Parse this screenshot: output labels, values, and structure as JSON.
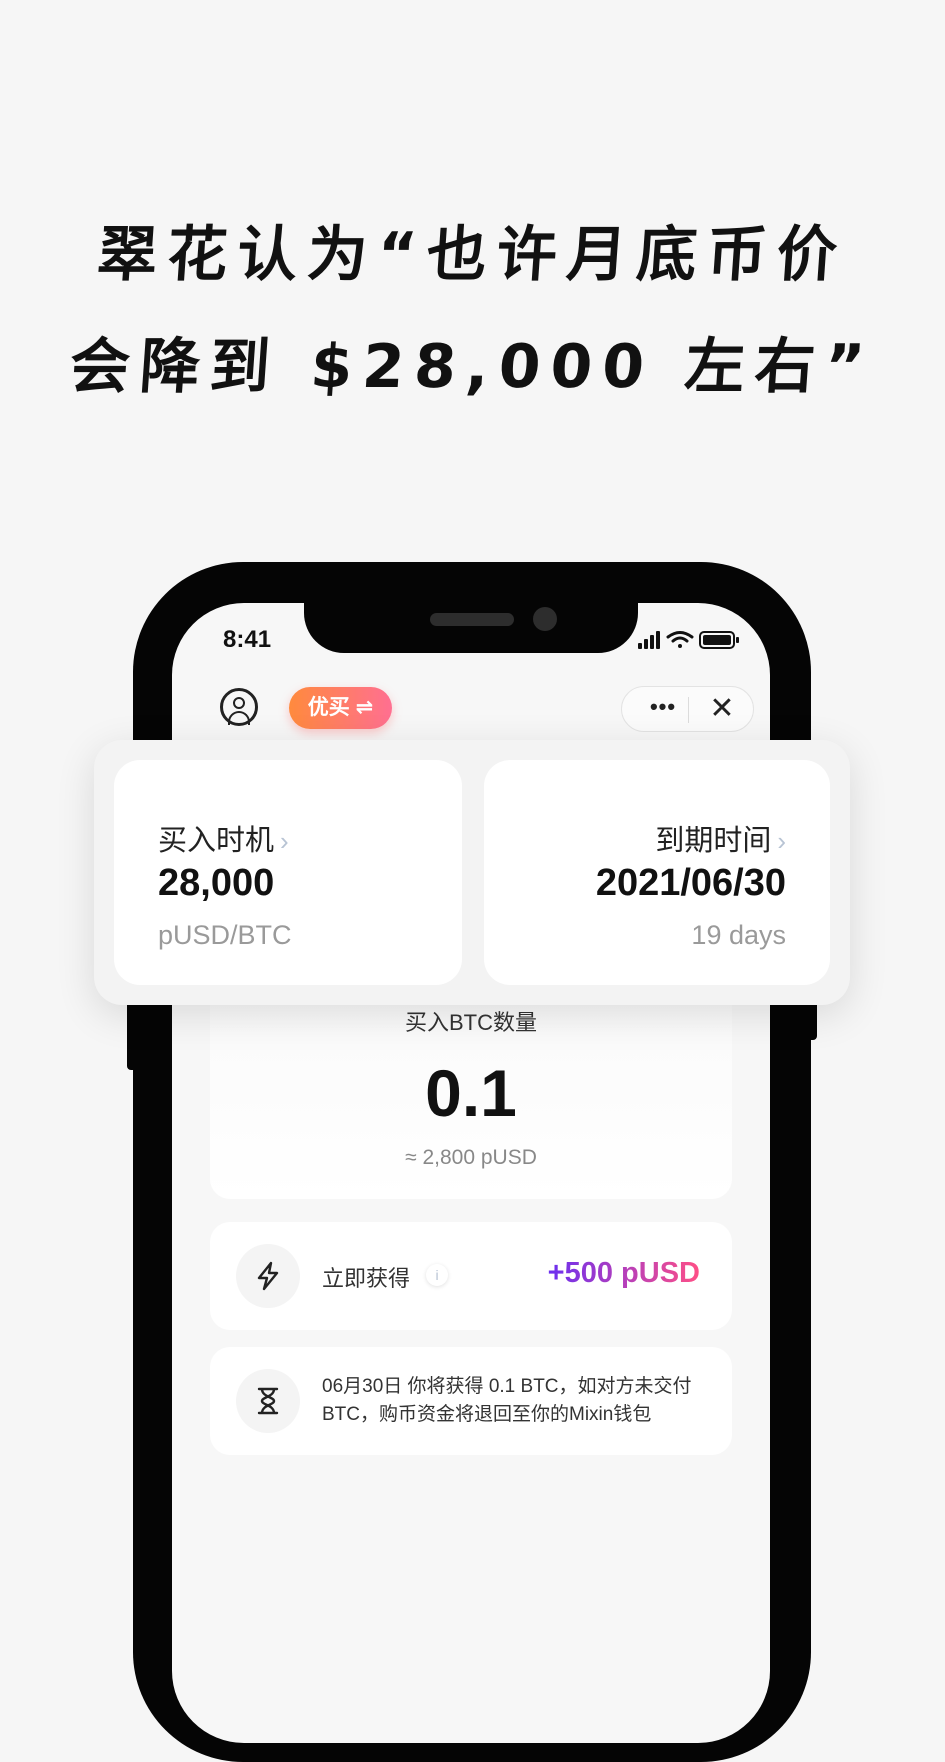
{
  "headline": {
    "line1": "翠花认为“也许月底币价",
    "line2": "会降到 $28,000 左右”"
  },
  "status_bar": {
    "time": "8:41"
  },
  "app_bar": {
    "pill_label": "优买 ⇌",
    "more_label": "•••",
    "close_label": "✕"
  },
  "overlay": {
    "buy_timing": {
      "label": "买入时机",
      "value": "28,000",
      "sub": "pUSD/BTC"
    },
    "expiry": {
      "label": "到期时间",
      "value": "2021/06/30",
      "sub": "19 days"
    }
  },
  "amount": {
    "label": "买入BTC数量",
    "value": "0.1",
    "approx": "≈ 2,800 pUSD"
  },
  "reward": {
    "label": "立即获得",
    "info_glyph": "i",
    "value": "+500 pUSD",
    "icon": "lightning-icon"
  },
  "info": {
    "text": "06月30日 你将获得 0.1 BTC，如对方未交付BTC，购币资金将退回至你的Mixin钱包",
    "icon": "hourglass-icon"
  },
  "colors": {
    "pill_gradient": [
      "#ff8a3d",
      "#ff6f91"
    ],
    "reward_gradient": [
      "#6a2ff0",
      "#ff4f86"
    ],
    "chevron": "#b8c4d4"
  }
}
